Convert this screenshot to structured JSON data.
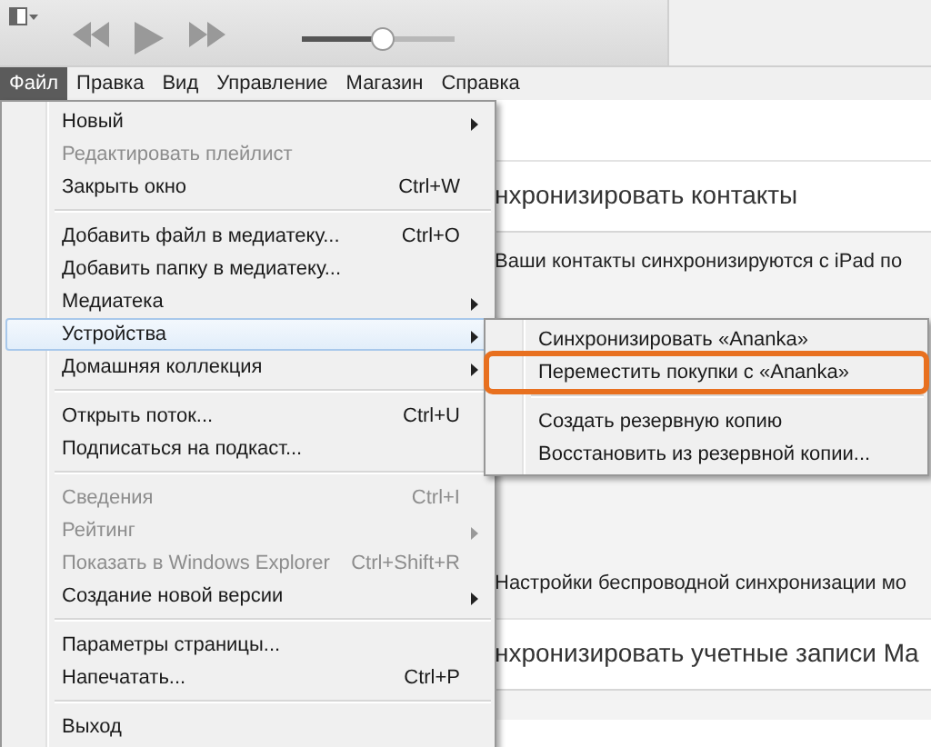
{
  "toolbar": {
    "volume": {
      "level": 0.52
    }
  },
  "menubar": [
    {
      "label": "Файл",
      "selected": true
    },
    {
      "label": "Правка",
      "selected": false
    },
    {
      "label": "Вид",
      "selected": false
    },
    {
      "label": "Управление",
      "selected": false
    },
    {
      "label": "Магазин",
      "selected": false
    },
    {
      "label": "Справка",
      "selected": false
    }
  ],
  "content": {
    "sections": [
      {
        "heading": "нхронизировать контакты",
        "lines": [
          "Ваши контакты синхронизируются с iPad по"
        ]
      },
      {
        "lines": [
          "Настройки беспроводной синхронизации мо"
        ]
      },
      {
        "heading": "нхронизировать учетные записи Ma"
      }
    ]
  },
  "file_menu": [
    {
      "kind": "item",
      "label": "Новый",
      "submenu": true,
      "disabled": false,
      "selected": false
    },
    {
      "kind": "item",
      "label": "Редактировать плейлист",
      "disabled": true,
      "selected": false
    },
    {
      "kind": "item",
      "label": "Закрыть окно",
      "shortcut": "Ctrl+W",
      "disabled": false,
      "selected": false
    },
    {
      "kind": "separator"
    },
    {
      "kind": "item",
      "label": "Добавить файл в медиатеку...",
      "shortcut": "Ctrl+O",
      "disabled": false,
      "selected": false
    },
    {
      "kind": "item",
      "label": "Добавить папку в медиатеку...",
      "disabled": false,
      "selected": false
    },
    {
      "kind": "item",
      "label": "Медиатека",
      "submenu": true,
      "disabled": false,
      "selected": false
    },
    {
      "kind": "item",
      "label": "Устройства",
      "submenu": true,
      "disabled": false,
      "selected": true
    },
    {
      "kind": "item",
      "label": "Домашняя коллекция",
      "submenu": true,
      "disabled": false,
      "selected": false
    },
    {
      "kind": "separator"
    },
    {
      "kind": "item",
      "label": "Открыть поток...",
      "shortcut": "Ctrl+U",
      "disabled": false,
      "selected": false
    },
    {
      "kind": "item",
      "label": "Подписаться на подкаст...",
      "disabled": false,
      "selected": false
    },
    {
      "kind": "separator"
    },
    {
      "kind": "item",
      "label": "Сведения",
      "shortcut": "Ctrl+I",
      "disabled": true,
      "selected": false
    },
    {
      "kind": "item",
      "label": "Рейтинг",
      "submenu": true,
      "disabled": true,
      "selected": false
    },
    {
      "kind": "item",
      "label": "Показать в Windows Explorer",
      "shortcut": "Ctrl+Shift+R",
      "disabled": true,
      "selected": false
    },
    {
      "kind": "item",
      "label": "Создание новой версии",
      "submenu": true,
      "disabled": false,
      "selected": false
    },
    {
      "kind": "separator"
    },
    {
      "kind": "item",
      "label": "Параметры страницы...",
      "disabled": false,
      "selected": false
    },
    {
      "kind": "item",
      "label": "Напечатать...",
      "shortcut": "Ctrl+P",
      "disabled": false,
      "selected": false
    },
    {
      "kind": "separator"
    },
    {
      "kind": "item",
      "label": "Выход",
      "disabled": false,
      "selected": false
    }
  ],
  "devices_submenu": [
    {
      "kind": "item",
      "label": "Синхронизировать «Ananka»",
      "disabled": false,
      "selected": false,
      "highlighted": false
    },
    {
      "kind": "item",
      "label": "Переместить покупки с «Ananka»",
      "disabled": false,
      "selected": false,
      "highlighted": true
    },
    {
      "kind": "separator"
    },
    {
      "kind": "item",
      "label": "Создать резервную копию",
      "disabled": false,
      "selected": false,
      "highlighted": false
    },
    {
      "kind": "item",
      "label": "Восстановить из резервной копии...",
      "disabled": false,
      "selected": false,
      "highlighted": false
    }
  ]
}
